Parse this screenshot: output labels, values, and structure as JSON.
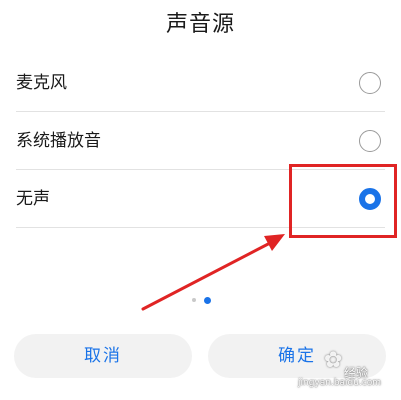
{
  "dialog": {
    "title": "声音源",
    "options": [
      {
        "label": "麦克风",
        "selected": false
      },
      {
        "label": "系统播放音",
        "selected": false
      },
      {
        "label": "无声",
        "selected": true
      }
    ],
    "pager": {
      "count": 2,
      "active_index": 1
    },
    "buttons": {
      "cancel_label": "取消",
      "confirm_label": "确定"
    }
  },
  "colors": {
    "accent": "#1a73e8",
    "annotation": "#e02424",
    "button_bg": "#f2f2f2"
  },
  "icons": {
    "radio_unchecked": "radio-unchecked-icon",
    "radio_checked": "radio-checked-icon",
    "watermark": "paw-icon"
  },
  "watermark": {
    "brand": "经验",
    "url": "jingyan.baidu.com"
  }
}
